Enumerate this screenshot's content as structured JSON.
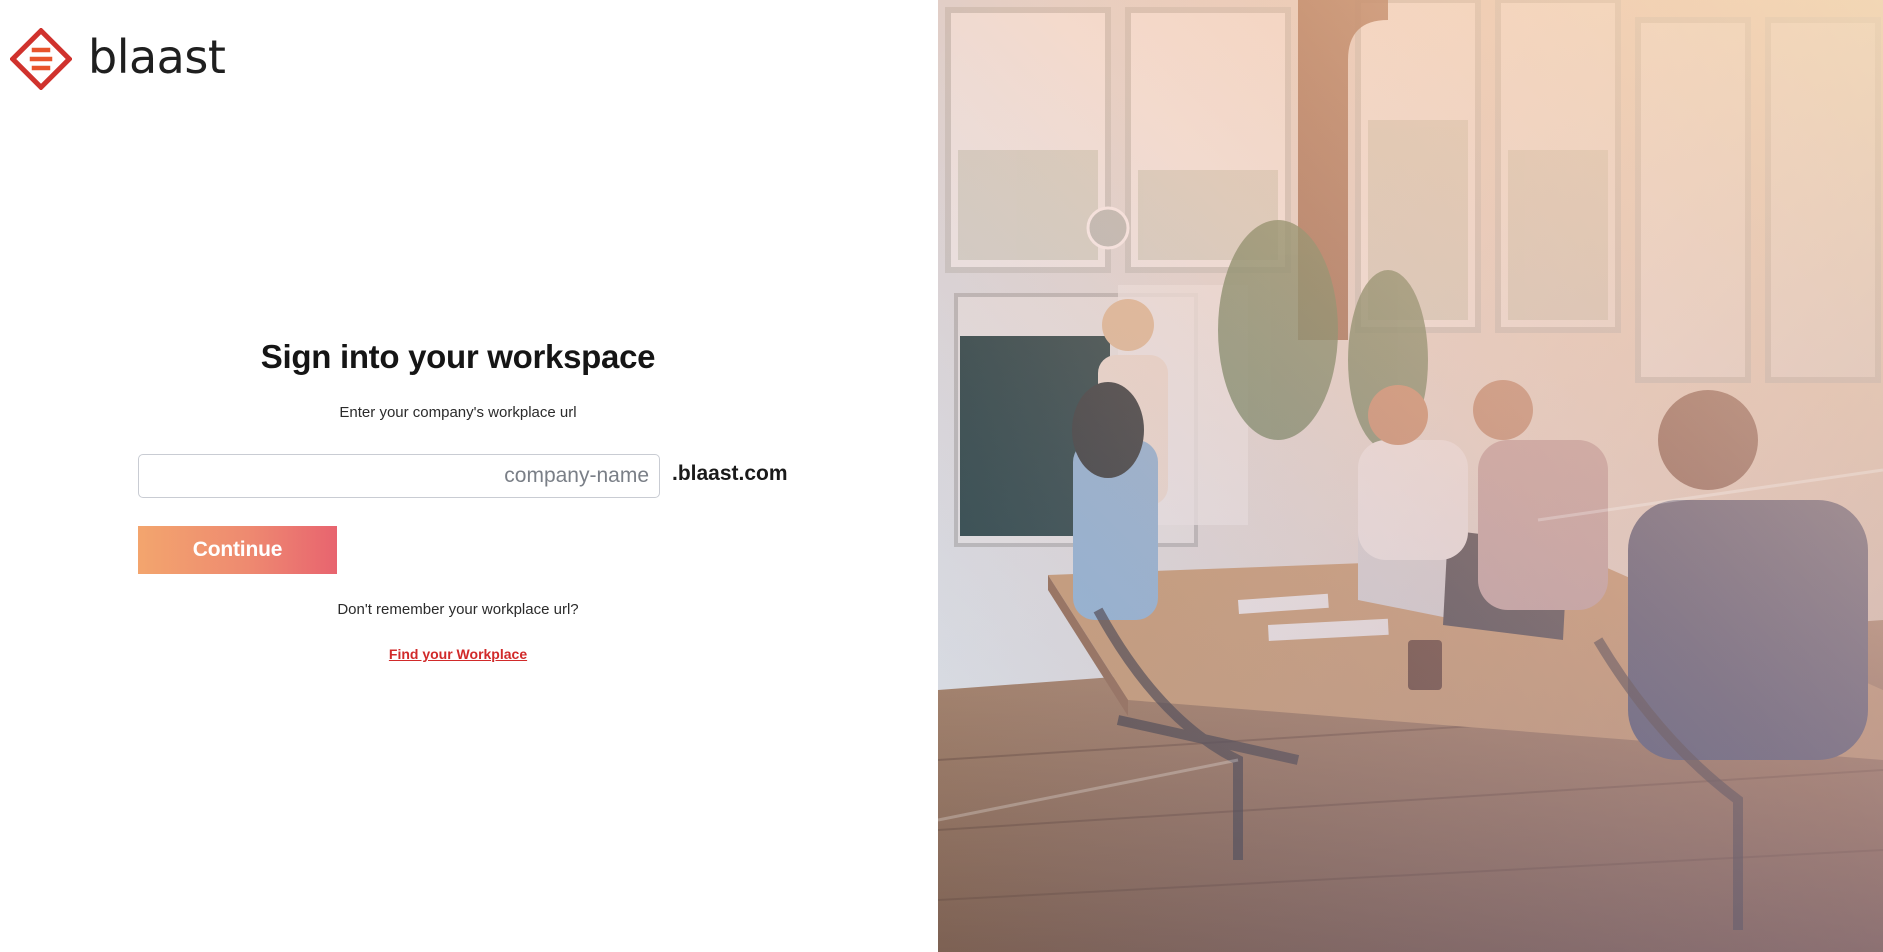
{
  "brand": {
    "name": "blaast",
    "logo_icon": "blaast-diamond-logo",
    "accent_color": "#d12a2a"
  },
  "signin": {
    "title": "Sign into your workspace",
    "subtitle": "Enter your company's workplace url",
    "url_input": {
      "value": "",
      "placeholder": "company-name"
    },
    "url_suffix": ".blaast.com",
    "continue_label": "Continue",
    "continue_gradient": [
      "#f3a56e",
      "#e8646f"
    ],
    "forgot_text": "Don't remember your workplace url?",
    "find_link_label": "Find your Workplace"
  },
  "hero_image": {
    "subject": "office-meeting-photo"
  }
}
